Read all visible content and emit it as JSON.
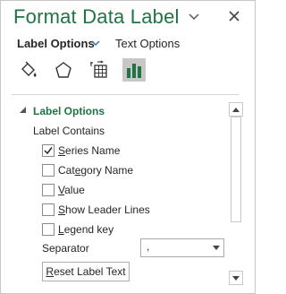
{
  "pane": {
    "title": "Format Data Label",
    "tabs": [
      {
        "label": "Label Options",
        "active": true
      },
      {
        "label": "Text Options",
        "active": false
      }
    ],
    "icon_tabs": [
      {
        "name": "fill-line-icon",
        "selected": false
      },
      {
        "name": "effects-icon",
        "selected": false
      },
      {
        "name": "size-properties-icon",
        "selected": false
      },
      {
        "name": "label-options-icon",
        "selected": true
      }
    ]
  },
  "section": {
    "title": "Label Options",
    "subtitle": "Label Contains",
    "options": [
      {
        "pre": "",
        "key": "S",
        "post": "eries Name",
        "checked": true
      },
      {
        "pre": "Cat",
        "key": "e",
        "post": "gory Name",
        "checked": false
      },
      {
        "pre": "",
        "key": "V",
        "post": "alue",
        "checked": false
      },
      {
        "pre": "",
        "key": "S",
        "post": "how Leader Lines",
        "checked": false
      },
      {
        "pre": "",
        "key": "L",
        "post": "egend key",
        "checked": false
      }
    ],
    "separator": {
      "label": "Separator",
      "value": ","
    },
    "reset": {
      "pre": "",
      "key": "R",
      "post": "eset Label Text"
    }
  },
  "colors": {
    "accent": "#217346",
    "selected_icon_bg": "#c7c7c7"
  }
}
